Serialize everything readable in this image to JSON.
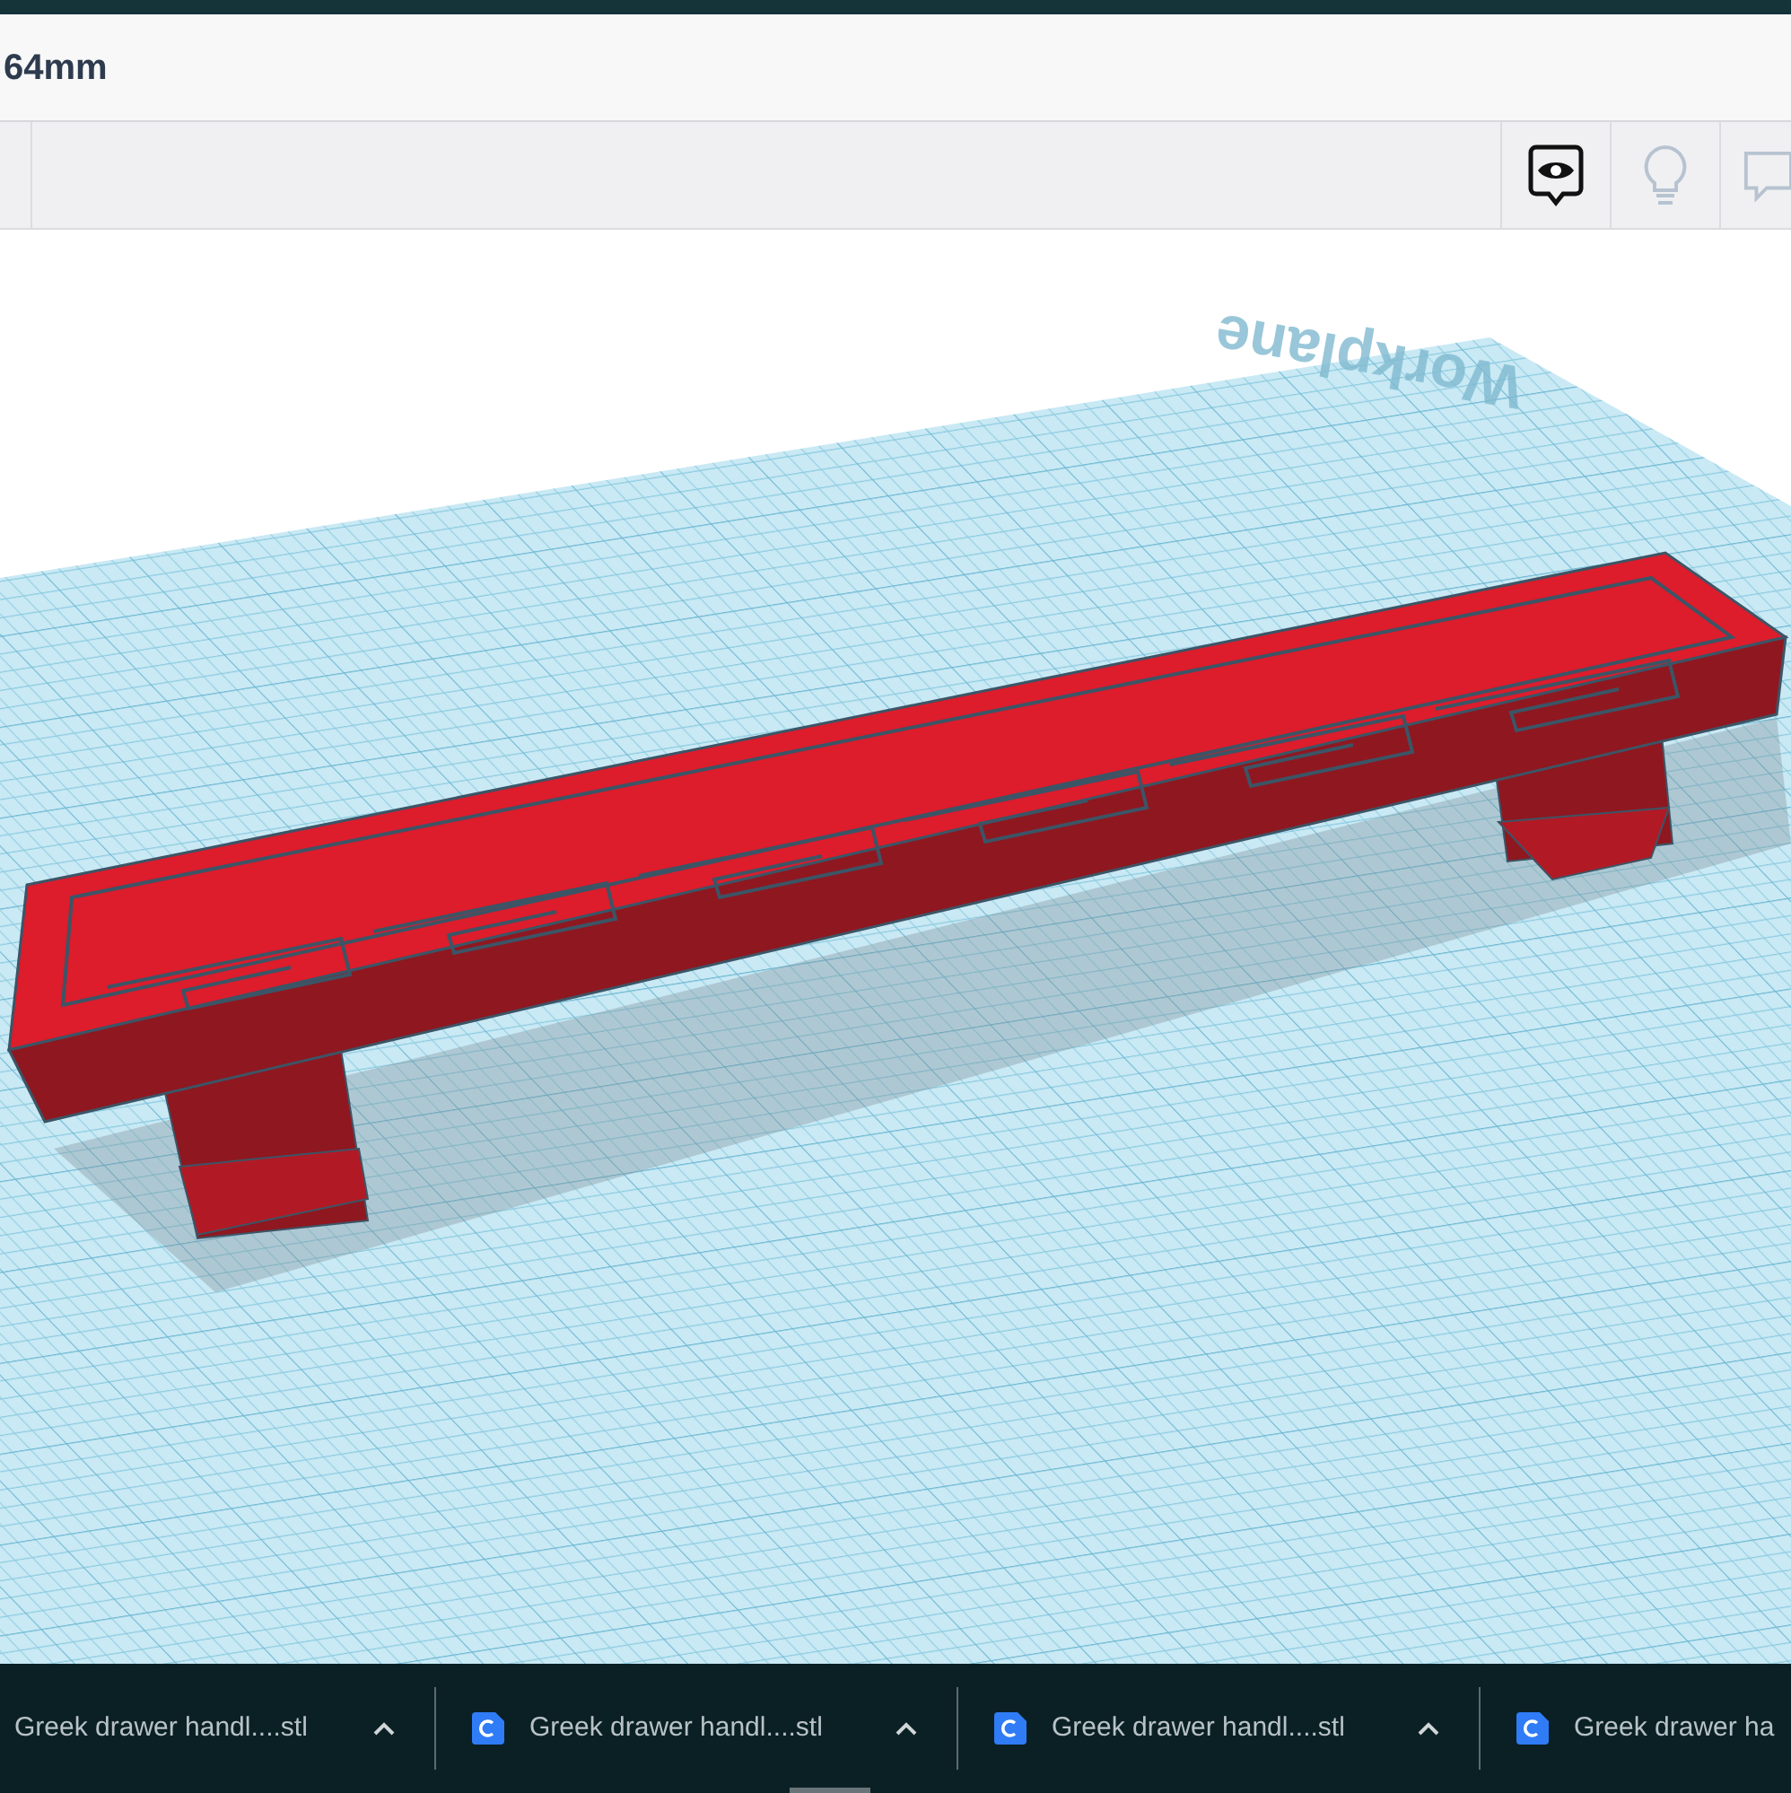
{
  "title_bar": {
    "dimension": "64mm"
  },
  "workplane": {
    "label": "Workplane"
  },
  "downloads": [
    {
      "name": "Greek drawer handl....stl",
      "icon": false,
      "caret": true
    },
    {
      "name": "Greek drawer handl....stl",
      "icon": true,
      "caret": true
    },
    {
      "name": "Greek drawer handl....stl",
      "icon": true,
      "caret": true
    },
    {
      "name": "Greek drawer ha",
      "icon": true,
      "caret": false
    }
  ]
}
